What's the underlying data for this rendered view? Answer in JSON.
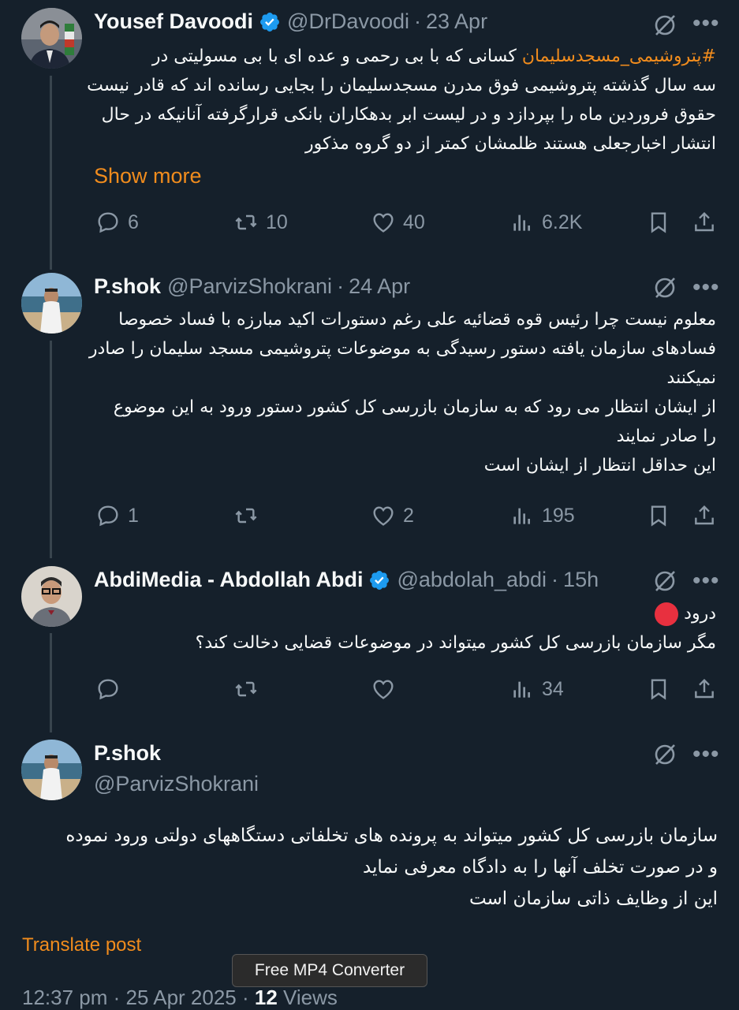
{
  "posts": [
    {
      "name": "Yousef Davoodi",
      "verified": true,
      "handle": "@DrDavoodi",
      "date": "23 Apr",
      "hashtag": "#پتروشیمی_مسجدسلیمان",
      "line1": " کسانی که با بی رحمی و عده ای با بی مسولیتی در",
      "lines": [
        "سه سال گذشته پتروشیمی فوق مدرن مسجدسلیمان را بجایی رسانده اند که قادر نیست",
        "حقوق فروردین ماه را بپردازد و در لیست ابر بدهکاران بانکی قرارگرفته آنانیکه در حال",
        "انتشار اخبارجعلی هستند ظلمشان کمتر از  دو گروه مذکور"
      ],
      "show_more": "Show more",
      "stats": {
        "replies": "6",
        "reposts": "10",
        "likes": "40",
        "views": "6.2K"
      }
    },
    {
      "name": "P.shok",
      "handle": "@ParvizShokrani",
      "date": "24 Apr",
      "lines": [
        "معلوم نیست چرا رئیس قوه قضائیه علی رغم دستورات اکید مبارزه با فساد خصوصا",
        "فسادهای سازمان یافته دستور رسیدگی به موضوعات پتروشیمی مسجد  سلیمان را صادر",
        "نمیکنند",
        "از ایشان انتظار می رود که به سازمان بازرسی کل کشور دستور ورود به این موضوع",
        "را صادر نمایند",
        "این حداقل انتظار از ایشان است"
      ],
      "stats": {
        "replies": "1",
        "reposts": "",
        "likes": "2",
        "views": "195"
      }
    },
    {
      "name": "AbdiMedia - Abdollah Abdi",
      "verified": true,
      "handle": "@abdolah_abdi",
      "date": "15h",
      "lines": [
        "درود",
        "مگر سازمان بازرسی کل کشور میتواند در موضوعات قضایی دخالت کند؟"
      ],
      "stats": {
        "replies": "",
        "reposts": "",
        "likes": "",
        "views": "34"
      }
    },
    {
      "name": "P.shok",
      "handle": "@ParvizShokrani",
      "lines": [
        "سازمان بازرسی کل کشور میتواند  به پرونده های تخلفاتی دستگاههای دولتی ورود نموده",
        "و در صورت تخلف آنها را به دادگاه معرفی نماید",
        "این از وظایف ذاتی سازمان است"
      ],
      "translate": "Translate post",
      "footer": {
        "time": "12:37 pm",
        "date": "25 Apr 2025",
        "views_count": "12",
        "views_label": "Views"
      }
    }
  ],
  "tooltip": "Free MP4 Converter",
  "colors": {
    "background": "#15202b",
    "accent": "#f18c1d",
    "muted": "#8b98a5",
    "verified": "#1d9bf0"
  }
}
